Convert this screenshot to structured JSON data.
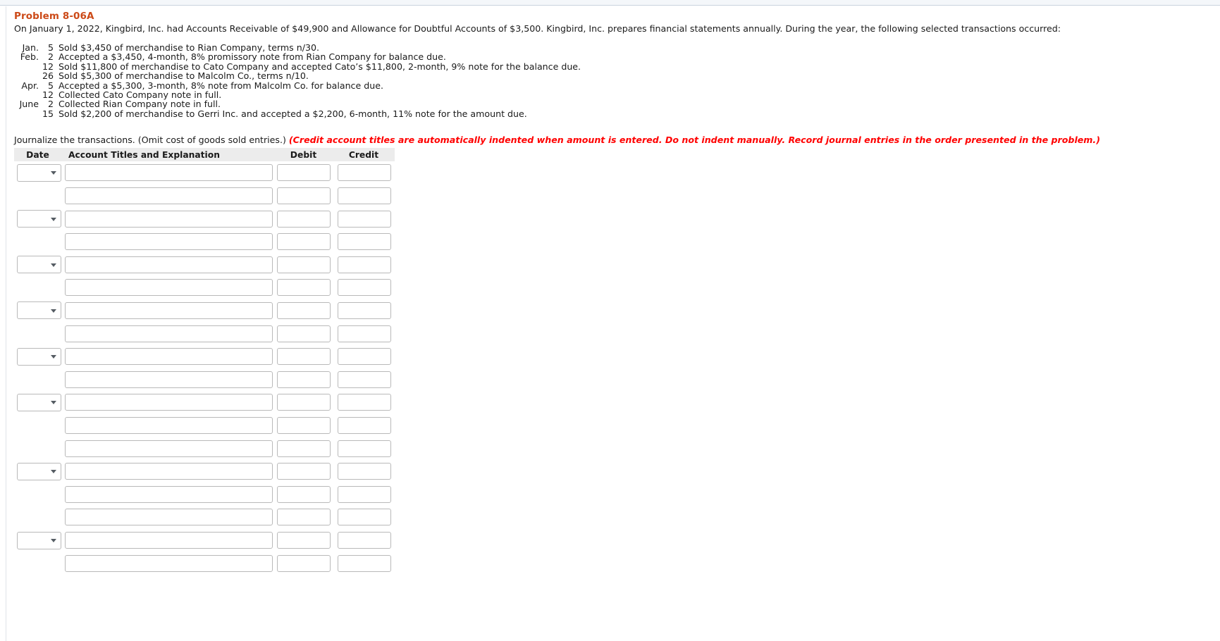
{
  "problem": {
    "title": "Problem 8-06A",
    "intro": "On January 1, 2022, Kingbird, Inc. had Accounts Receivable of $49,900 and Allowance for Doubtful Accounts of $3,500. Kingbird, Inc. prepares financial statements annually. During the year, the following selected transactions occurred:"
  },
  "transactions": [
    {
      "month": "Jan.",
      "day": "5",
      "desc": "Sold $3,450 of merchandise to Rian Company, terms n/30."
    },
    {
      "month": "Feb.",
      "day": "2",
      "desc": "Accepted a $3,450, 4-month, 8% promissory note from Rian Company for balance due."
    },
    {
      "month": "",
      "day": "12",
      "desc": "Sold $11,800 of merchandise to Cato Company and accepted Cato’s $11,800, 2-month, 9% note for the balance due."
    },
    {
      "month": "",
      "day": "26",
      "desc": "Sold $5,300 of merchandise to Malcolm Co., terms n/10."
    },
    {
      "month": "Apr.",
      "day": "5",
      "desc": "Accepted a $5,300, 3-month, 8% note from Malcolm Co. for balance due."
    },
    {
      "month": "",
      "day": "12",
      "desc": "Collected Cato Company note in full."
    },
    {
      "month": "June",
      "day": "2",
      "desc": "Collected Rian Company note in full."
    },
    {
      "month": "",
      "day": "15",
      "desc": "Sold $2,200 of merchandise to Gerri Inc. and accepted a $2,200, 6-month, 11% note for the amount due."
    }
  ],
  "instruction": {
    "main": "Journalize the transactions. (Omit cost of goods sold entries.) ",
    "hint": "(Credit account titles are automatically indented when amount is entered. Do not indent manually. Record journal entries in the order presented in the problem.)"
  },
  "journal": {
    "headers": {
      "date": "Date",
      "account": "Account Titles and Explanation",
      "debit": "Debit",
      "credit": "Credit"
    },
    "date_placeholder": "",
    "date_value": "",
    "account_placeholder": "",
    "amount_placeholder": "",
    "rows": [
      {
        "has_date": true,
        "date": "",
        "account": "",
        "debit": "",
        "credit": ""
      },
      {
        "has_date": false,
        "date": "",
        "account": "",
        "debit": "",
        "credit": ""
      },
      {
        "has_date": true,
        "date": "",
        "account": "",
        "debit": "",
        "credit": ""
      },
      {
        "has_date": false,
        "date": "",
        "account": "",
        "debit": "",
        "credit": ""
      },
      {
        "has_date": true,
        "date": "",
        "account": "",
        "debit": "",
        "credit": ""
      },
      {
        "has_date": false,
        "date": "",
        "account": "",
        "debit": "",
        "credit": ""
      },
      {
        "has_date": true,
        "date": "",
        "account": "",
        "debit": "",
        "credit": ""
      },
      {
        "has_date": false,
        "date": "",
        "account": "",
        "debit": "",
        "credit": ""
      },
      {
        "has_date": true,
        "date": "",
        "account": "",
        "debit": "",
        "credit": ""
      },
      {
        "has_date": false,
        "date": "",
        "account": "",
        "debit": "",
        "credit": ""
      },
      {
        "has_date": true,
        "date": "",
        "account": "",
        "debit": "",
        "credit": ""
      },
      {
        "has_date": false,
        "date": "",
        "account": "",
        "debit": "",
        "credit": ""
      },
      {
        "has_date": false,
        "date": "",
        "account": "",
        "debit": "",
        "credit": ""
      },
      {
        "has_date": true,
        "date": "",
        "account": "",
        "debit": "",
        "credit": ""
      },
      {
        "has_date": false,
        "date": "",
        "account": "",
        "debit": "",
        "credit": ""
      },
      {
        "has_date": false,
        "date": "",
        "account": "",
        "debit": "",
        "credit": ""
      },
      {
        "has_date": true,
        "date": "",
        "account": "",
        "debit": "",
        "credit": ""
      },
      {
        "has_date": false,
        "date": "",
        "account": "",
        "debit": "",
        "credit": ""
      }
    ]
  }
}
